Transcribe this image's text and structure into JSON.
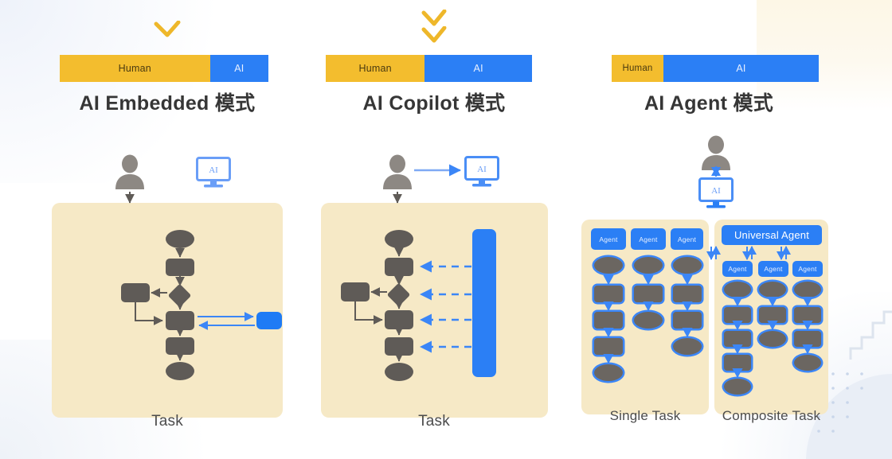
{
  "panels": [
    {
      "id": "ai-embedded",
      "title": "AI Embedded 模式",
      "chevron_count": 1,
      "bar": {
        "human_label": "Human",
        "ai_label": "AI",
        "human_pct": 72,
        "ai_pct": 28
      },
      "actors": {
        "person": "person-icon",
        "monitor_label": "AI"
      },
      "task_label": "Task",
      "flow": [
        "start-ellipse",
        "process-rect",
        "decision-diamond",
        "branch-rect",
        "process-rect",
        "process-rect",
        "end-ellipse"
      ],
      "ai_block_label": ""
    },
    {
      "id": "ai-copilot",
      "title": "AI Copilot 模式",
      "chevron_count": 2,
      "bar": {
        "human_label": "Human",
        "ai_label": "AI",
        "human_pct": 48,
        "ai_pct": 52
      },
      "actors": {
        "person": "person-icon",
        "monitor_label": "AI"
      },
      "task_label": "Task",
      "flow": [
        "start-ellipse",
        "process-rect",
        "decision-diamond",
        "branch-rect",
        "process-rect",
        "process-rect",
        "end-ellipse"
      ],
      "assist_arrow_count": 4
    },
    {
      "id": "ai-agent",
      "title": "AI Agent 模式",
      "chevron_count": 0,
      "bar": {
        "human_label": "Human",
        "ai_label": "AI",
        "human_pct": 25,
        "ai_pct": 75
      },
      "actors": {
        "person": "person-icon",
        "monitor_label": "AI"
      },
      "single_task": {
        "label": "Single Task",
        "agent_label": "Agent",
        "columns": [
          [
            "ellipse",
            "rect",
            "rect",
            "rect",
            "ellipse"
          ],
          [
            "ellipse",
            "rect",
            "ellipse"
          ],
          [
            "ellipse",
            "rect",
            "rect",
            "ellipse"
          ]
        ]
      },
      "composite_task": {
        "label": "Composite Task",
        "universal_agent_label": "Universal Agent",
        "agent_label": "Agent",
        "columns": [
          [
            "ellipse",
            "rect",
            "rect",
            "rect",
            "ellipse"
          ],
          [
            "ellipse",
            "rect",
            "ellipse"
          ],
          [
            "ellipse",
            "rect",
            "rect",
            "ellipse"
          ]
        ]
      }
    }
  ],
  "colors": {
    "human": "#f3bd2e",
    "ai": "#2b7ff5",
    "task_bg": "#f6e9c6",
    "shape": "#5f5b57",
    "title": "#363636",
    "arrow_blue": "#3b86f7",
    "arrow_gray": "#5f5b57"
  }
}
